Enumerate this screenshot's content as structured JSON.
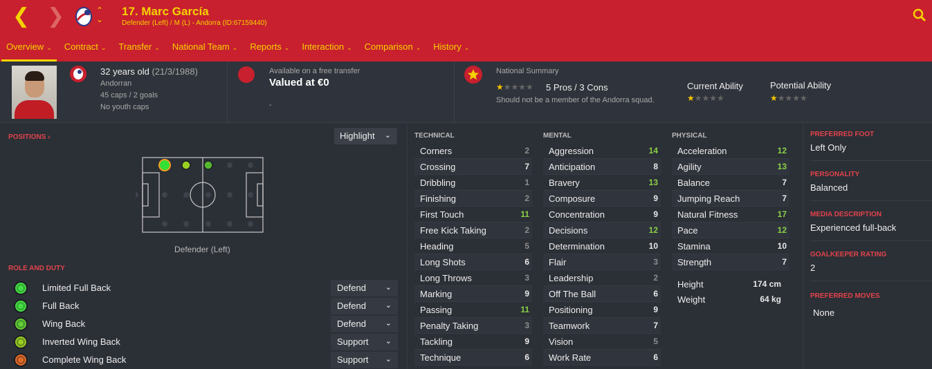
{
  "header": {
    "title": "17. Marc García",
    "subtitle": "Defender (Left) / M (L) - Andorra (ID:67159440)",
    "nav": [
      {
        "label": "Overview",
        "active": true
      },
      {
        "label": "Contract"
      },
      {
        "label": "Transfer"
      },
      {
        "label": "National Team"
      },
      {
        "label": "Reports"
      },
      {
        "label": "Interaction"
      },
      {
        "label": "Comparison"
      },
      {
        "label": "History"
      }
    ],
    "colors": {
      "bar": "#c8202e",
      "accent": "#f5d300"
    }
  },
  "summary": {
    "age": "32 years old",
    "dob": "(21/3/1988)",
    "nationality": "Andorran",
    "caps": "45 caps / 2 goals",
    "youth": "No youth caps",
    "transfer_label": "Available on a free transfer",
    "value": "Valued at €0",
    "value_dash": "-",
    "national_summary_label": "National Summary",
    "pros_cons": "5 Pros / 3 Cons",
    "national_note": "Should not be a member of the Andorra squad.",
    "current_ability_label": "Current Ability",
    "potential_ability_label": "Potential Ability",
    "national_stars": 1,
    "current_ability_stars": 1,
    "potential_ability_stars": 1
  },
  "positions": {
    "title": "POSITIONS",
    "highlight_button": "Highlight",
    "position_label": "Defender (Left)"
  },
  "roles": {
    "title": "ROLE AND DUTY",
    "items": [
      {
        "name": "Limited Full Back",
        "duty": "Defend"
      },
      {
        "name": "Full Back",
        "duty": "Defend"
      },
      {
        "name": "Wing Back",
        "duty": "Defend"
      },
      {
        "name": "Inverted Wing Back",
        "duty": "Support"
      },
      {
        "name": "Complete Wing Back",
        "duty": "Support"
      }
    ]
  },
  "attributes": {
    "technical": {
      "title": "TECHNICAL",
      "items": [
        {
          "name": "Corners",
          "value": "2"
        },
        {
          "name": "Crossing",
          "value": "7"
        },
        {
          "name": "Dribbling",
          "value": "1"
        },
        {
          "name": "Finishing",
          "value": "2"
        },
        {
          "name": "First Touch",
          "value": "11"
        },
        {
          "name": "Free Kick Taking",
          "value": "2"
        },
        {
          "name": "Heading",
          "value": "5"
        },
        {
          "name": "Long Shots",
          "value": "6"
        },
        {
          "name": "Long Throws",
          "value": "3"
        },
        {
          "name": "Marking",
          "value": "9"
        },
        {
          "name": "Passing",
          "value": "11"
        },
        {
          "name": "Penalty Taking",
          "value": "3"
        },
        {
          "name": "Tackling",
          "value": "9"
        },
        {
          "name": "Technique",
          "value": "6"
        }
      ]
    },
    "mental": {
      "title": "MENTAL",
      "items": [
        {
          "name": "Aggression",
          "value": "14"
        },
        {
          "name": "Anticipation",
          "value": "8"
        },
        {
          "name": "Bravery",
          "value": "13"
        },
        {
          "name": "Composure",
          "value": "9"
        },
        {
          "name": "Concentration",
          "value": "9"
        },
        {
          "name": "Decisions",
          "value": "12"
        },
        {
          "name": "Determination",
          "value": "10"
        },
        {
          "name": "Flair",
          "value": "3"
        },
        {
          "name": "Leadership",
          "value": "2"
        },
        {
          "name": "Off The Ball",
          "value": "6"
        },
        {
          "name": "Positioning",
          "value": "9"
        },
        {
          "name": "Teamwork",
          "value": "7"
        },
        {
          "name": "Vision",
          "value": "5"
        },
        {
          "name": "Work Rate",
          "value": "6"
        }
      ]
    },
    "physical": {
      "title": "PHYSICAL",
      "items": [
        {
          "name": "Acceleration",
          "value": "12"
        },
        {
          "name": "Agility",
          "value": "13"
        },
        {
          "name": "Balance",
          "value": "7"
        },
        {
          "name": "Jumping Reach",
          "value": "7"
        },
        {
          "name": "Natural Fitness",
          "value": "17"
        },
        {
          "name": "Pace",
          "value": "12"
        },
        {
          "name": "Stamina",
          "value": "10"
        },
        {
          "name": "Strength",
          "value": "7"
        }
      ],
      "height_label": "Height",
      "height": "174 cm",
      "weight_label": "Weight",
      "weight": "64 kg"
    }
  },
  "side": {
    "preferred_foot_label": "PREFERRED FOOT",
    "preferred_foot": "Left Only",
    "personality_label": "PERSONALITY",
    "personality": "Balanced",
    "media_label": "MEDIA DESCRIPTION",
    "media": "Experienced full-back",
    "gk_label": "GOALKEEPER RATING",
    "gk": "2",
    "moves_label": "PREFERRED MOVES",
    "moves": "None"
  }
}
